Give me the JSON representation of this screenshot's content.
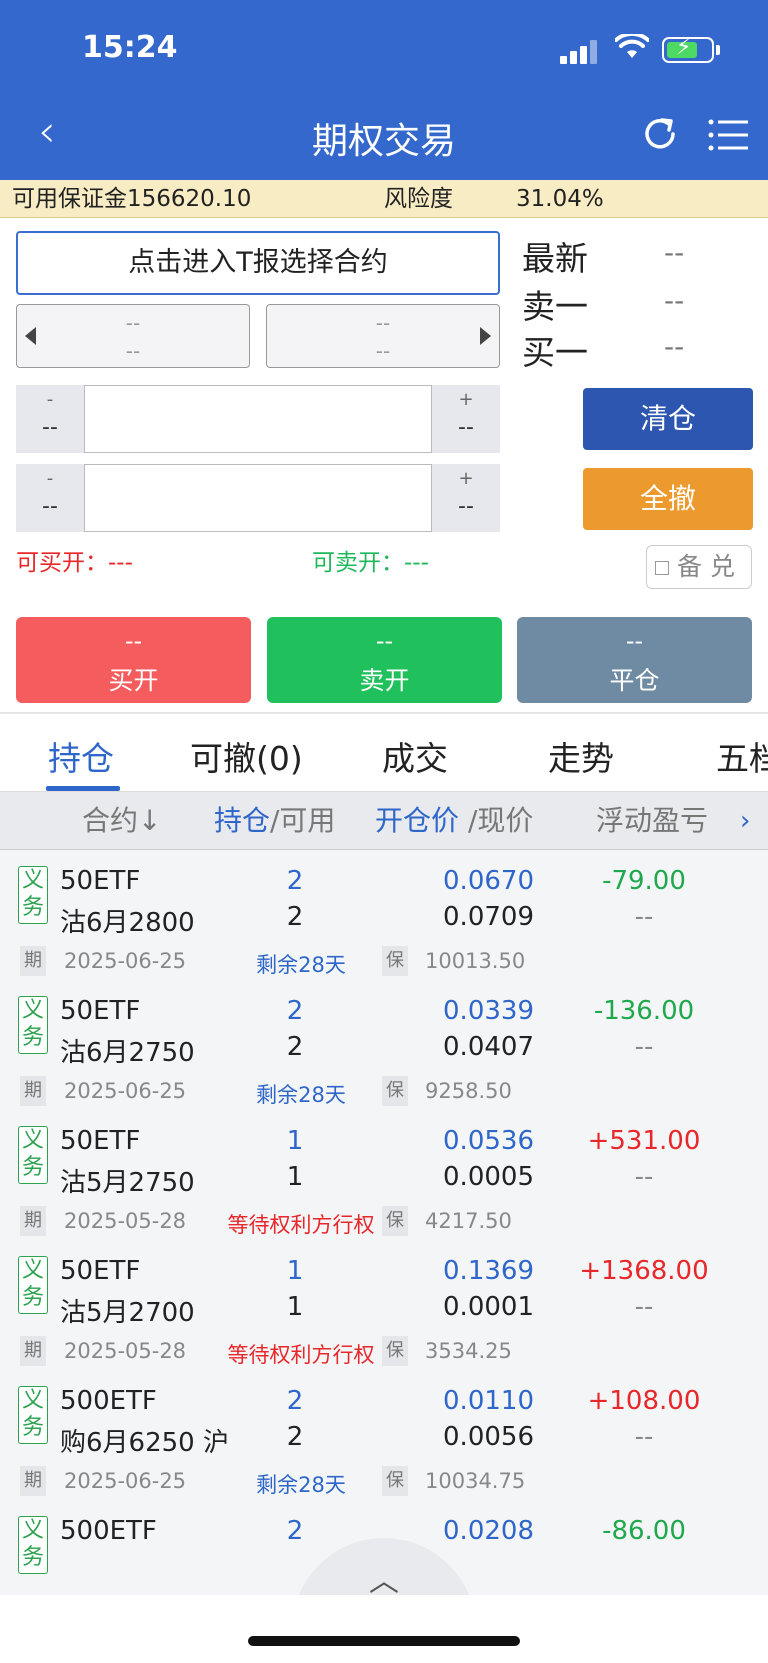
{
  "status": {
    "time": "15:24"
  },
  "header": {
    "title": "期权交易"
  },
  "account": {
    "margin_label": "可用保证金156620.10",
    "risk_label": "风险度",
    "risk_value": "31.04%"
  },
  "order": {
    "contract_select": "点击进入T报选择合约",
    "left_top": "--",
    "left_bottom": "--",
    "right_top": "--",
    "right_bottom": "--",
    "price_minus": "-",
    "price_minus_val": "--",
    "price_plus": "+",
    "price_plus_val": "--",
    "qty_minus": "-",
    "qty_minus_val": "--",
    "qty_plus": "+",
    "qty_plus_val": "--",
    "can_buy_label": "可买开：---",
    "can_sell_label": "可卖开：---",
    "cover_label": "备 兑"
  },
  "quote": {
    "latest_label": "最新",
    "latest_value": "--",
    "ask_label": "卖一",
    "ask_value": "--",
    "bid_label": "买一",
    "bid_value": "--"
  },
  "side_buttons": {
    "clear": "清仓",
    "cancel_all": "全撤"
  },
  "actions": {
    "buy_value": "--",
    "buy_label": "买开",
    "sell_value": "--",
    "sell_label": "卖开",
    "close_value": "--",
    "close_label": "平仓"
  },
  "tabs": [
    "持仓",
    "可撤(0)",
    "成交",
    "走势",
    "五档"
  ],
  "table_header": {
    "contract": "合约↓",
    "position": "持仓",
    "available": "/可用",
    "open_price": "开仓价",
    "now_price": "/现价",
    "float_pl": "浮动盈亏",
    "more": "›"
  },
  "positions": [
    {
      "tag": "义务",
      "name": "50ETF",
      "detail": "沽6月2800",
      "pos": "2",
      "avail": "2",
      "open_price": "0.0670",
      "now_price": "0.0709",
      "pl": "-79.00",
      "pl2": "--",
      "qi": "期",
      "date": "2025-06-25",
      "remain": "剩余28天",
      "bao": "保",
      "margin": "10013.50"
    },
    {
      "tag": "义务",
      "name": "50ETF",
      "detail": "沽6月2750",
      "pos": "2",
      "avail": "2",
      "open_price": "0.0339",
      "now_price": "0.0407",
      "pl": "-136.00",
      "pl2": "--",
      "qi": "期",
      "date": "2025-06-25",
      "remain": "剩余28天",
      "bao": "保",
      "margin": "9258.50"
    },
    {
      "tag": "义务",
      "name": "50ETF",
      "detail": "沽5月2750",
      "pos": "1",
      "avail": "1",
      "open_price": "0.0536",
      "now_price": "0.0005",
      "pl": "+531.00",
      "pl2": "--",
      "qi": "期",
      "date": "2025-05-28",
      "remain": "等待权利方行权",
      "bao": "保",
      "margin": "4217.50"
    },
    {
      "tag": "义务",
      "name": "50ETF",
      "detail": "沽5月2700",
      "pos": "1",
      "avail": "1",
      "open_price": "0.1369",
      "now_price": "0.0001",
      "pl": "+1368.00",
      "pl2": "--",
      "qi": "期",
      "date": "2025-05-28",
      "remain": "等待权利方行权",
      "bao": "保",
      "margin": "3534.25"
    },
    {
      "tag": "义务",
      "name": "500ETF",
      "detail": "购6月6250 沪",
      "pos": "2",
      "avail": "2",
      "open_price": "0.0110",
      "now_price": "0.0056",
      "pl": "+108.00",
      "pl2": "--",
      "qi": "期",
      "date": "2025-06-25",
      "remain": "剩余28天",
      "bao": "保",
      "margin": "10034.75"
    },
    {
      "tag": "义务",
      "name": "500ETF",
      "detail": "",
      "pos": "2",
      "avail": "",
      "open_price": "0.0208",
      "now_price": "",
      "pl": "-86.00",
      "pl2": "",
      "qi": "",
      "date": "",
      "remain": "",
      "bao": "",
      "margin": ""
    }
  ],
  "colors": {
    "header": "#3568cc",
    "profit": "#e8272a",
    "loss": "#1fa84c",
    "accent": "#2e66c9",
    "wait": "#e8272a"
  },
  "scroll_top": "︿"
}
